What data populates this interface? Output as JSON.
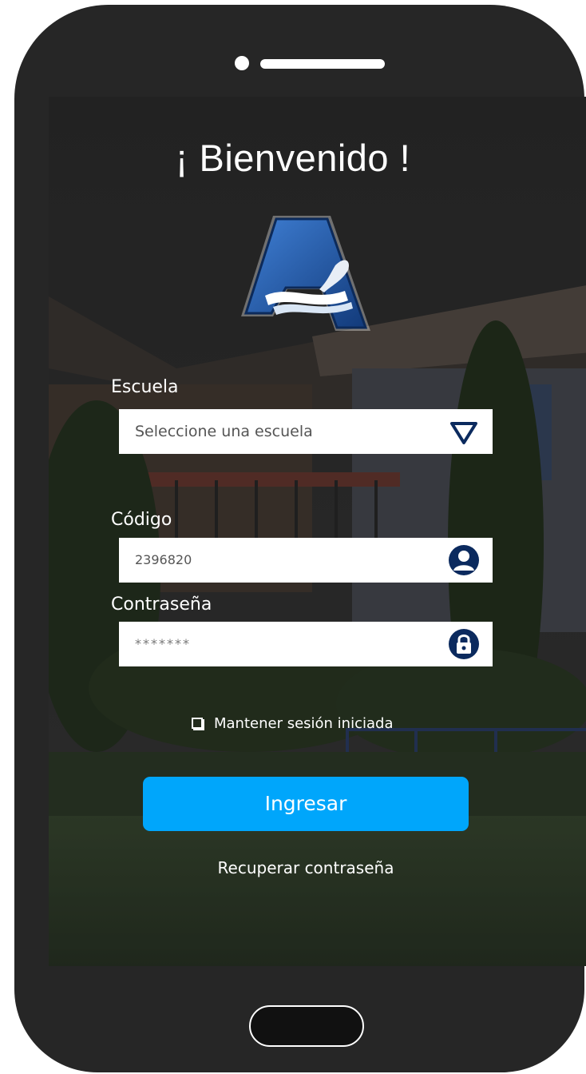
{
  "header": {
    "title": "¡ Bienvenido !"
  },
  "form": {
    "school": {
      "label": "Escuela",
      "placeholder": "Seleccione una escuela"
    },
    "code": {
      "label": "Código",
      "value": "2396820"
    },
    "password": {
      "label": "Contraseña",
      "value": "*******"
    },
    "keep_session": {
      "label": "Mantener sesión iniciada",
      "checked": false
    },
    "submit_label": "Ingresar",
    "recover_label": "Recuperar contraseña"
  },
  "icons": {
    "school_dropdown": "triangle-down-icon",
    "code": "user-icon",
    "password": "lock-icon"
  },
  "colors": {
    "accent": "#00a6fb",
    "icon_navy": "#0b2a5e",
    "phone_body": "#262626"
  }
}
